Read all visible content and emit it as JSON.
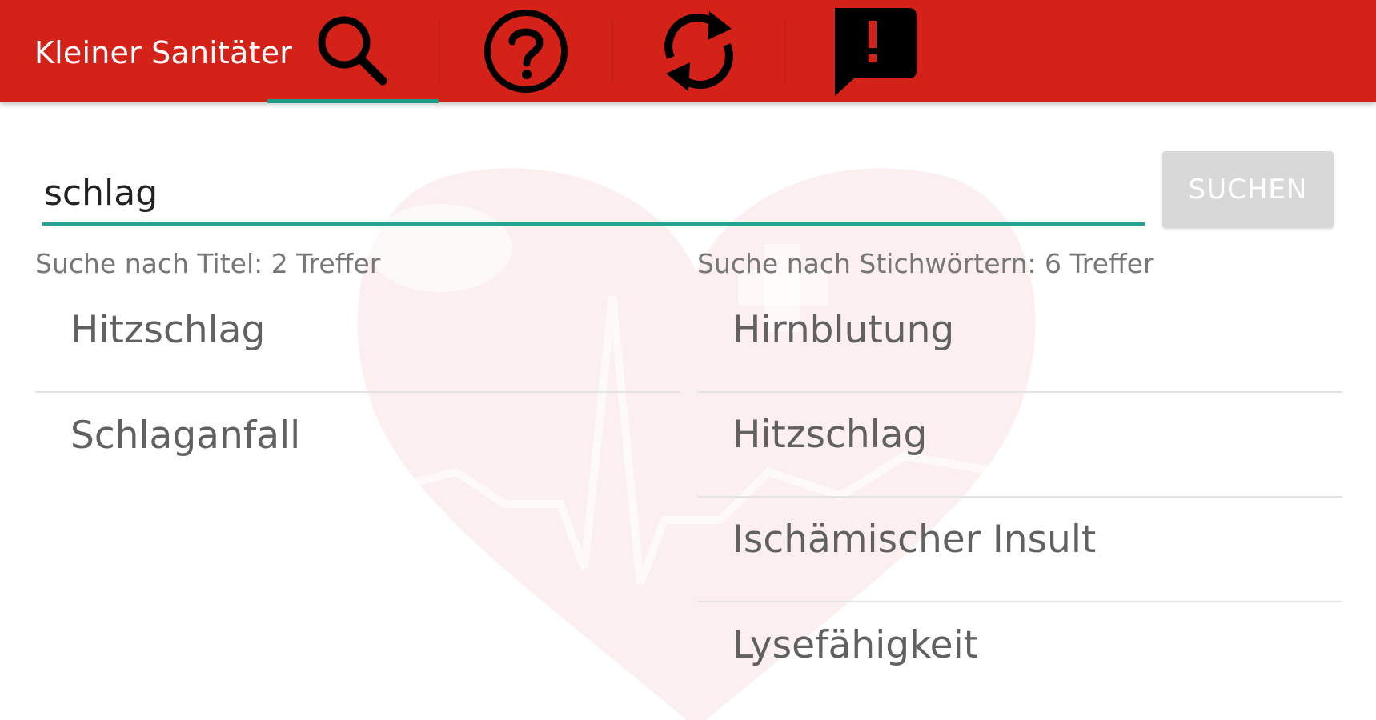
{
  "app": {
    "title": "Kleiner Sanitäter"
  },
  "toolbar": {
    "tabs": [
      {
        "id": "search",
        "icon": "search-icon",
        "selected": true
      },
      {
        "id": "help",
        "icon": "help-icon",
        "selected": false
      },
      {
        "id": "sync",
        "icon": "sync-icon",
        "selected": false
      },
      {
        "id": "feedback",
        "icon": "feedback-icon",
        "selected": false
      }
    ]
  },
  "search": {
    "query": "schlag",
    "button_label": "SUCHEN"
  },
  "results": {
    "title_column": {
      "label": "Suche nach Titel: 2 Treffer",
      "items": [
        "Hitzschlag",
        "Schlaganfall"
      ]
    },
    "keyword_column": {
      "label": "Suche nach Stichwörtern: 6 Treffer",
      "items": [
        "Hirnblutung",
        "Hitzschlag",
        "Ischämischer Insult",
        "Lysefähigkeit"
      ]
    }
  },
  "colors": {
    "toolbar": "#d42219",
    "accent": "#26a295",
    "button_disabled": "#d8d8d8",
    "text_secondary": "#777777",
    "list_text": "#616161"
  }
}
